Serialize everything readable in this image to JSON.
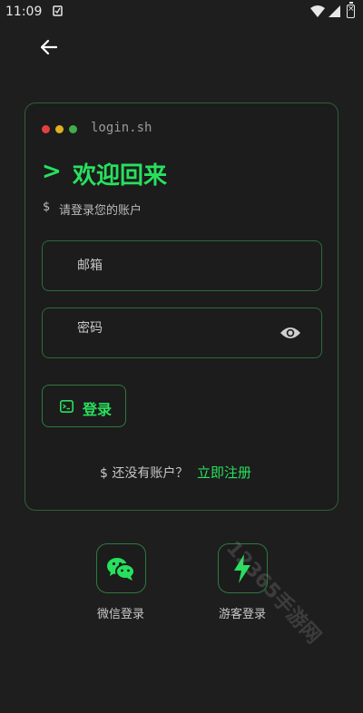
{
  "status_bar": {
    "time": "11:09"
  },
  "card": {
    "window_title": "login.sh",
    "window_dots": [
      "#e34040",
      "#e0b020",
      "#3fae4a"
    ],
    "prompt_symbol": ">",
    "title": "欢迎回来",
    "subtitle_prefix": "$",
    "subtitle": "请登录您的账户",
    "email_placeholder": "邮箱",
    "password_placeholder": "密码",
    "login_label": "登录",
    "register_question": "$ 还没有账户？",
    "register_link": "立即注册"
  },
  "social": [
    {
      "label": "微信登录",
      "icon": "wechat-icon"
    },
    {
      "label": "游客登录",
      "icon": "lightning-icon"
    }
  ],
  "watermark": "12365手游网",
  "colors": {
    "accent": "#27e15e",
    "border": "#2d6b3b",
    "background": "#1e1e1e"
  }
}
